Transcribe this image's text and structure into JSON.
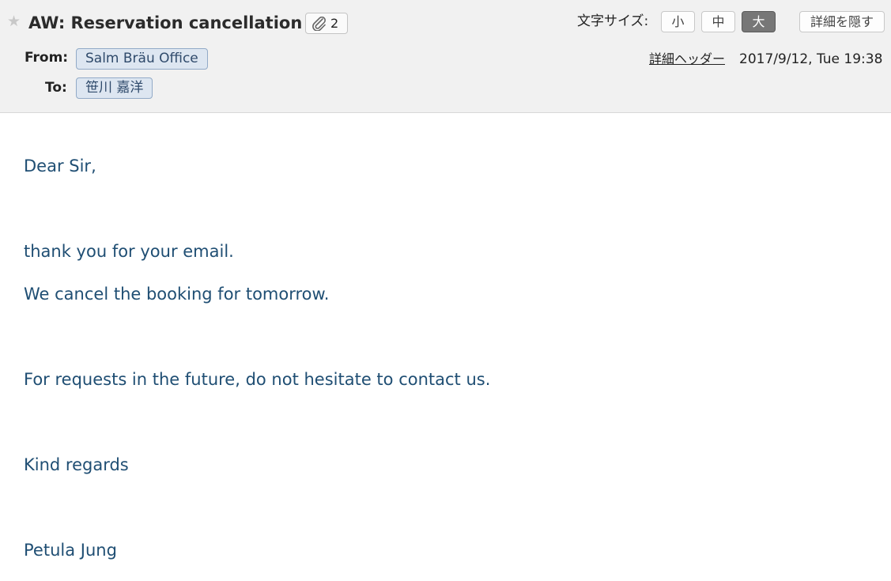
{
  "header": {
    "star_icon": "star-icon",
    "subject": "AW: Reservation cancellation",
    "attachment": {
      "icon": "paperclip-icon",
      "count": "2"
    },
    "font_size": {
      "label": "文字サイズ:",
      "small": "小",
      "medium": "中",
      "large": "大",
      "selected": "large"
    },
    "hide_details_label": "詳細を隠す",
    "from_label": "From:",
    "from_value": "Salm Bräu Office",
    "to_label": "To:",
    "to_value": "笹川 嘉洋",
    "detail_header_link": "詳細ヘッダー",
    "date": "2017/9/12, Tue 19:38"
  },
  "body": {
    "greeting": "Dear Sir,",
    "line1": "thank you for your email.",
    "line2": "We cancel the booking for tomorrow.",
    "line3": "For requests in the future, do not hesitate to contact us.",
    "closing": "Kind regards",
    "signature": "Petula Jung"
  },
  "colors": {
    "header_bg": "#f1f1f1",
    "body_text": "#1f4e73",
    "address_chip_bg": "#dde6f1",
    "address_chip_border": "#92aac7",
    "active_button_bg": "#777777"
  }
}
